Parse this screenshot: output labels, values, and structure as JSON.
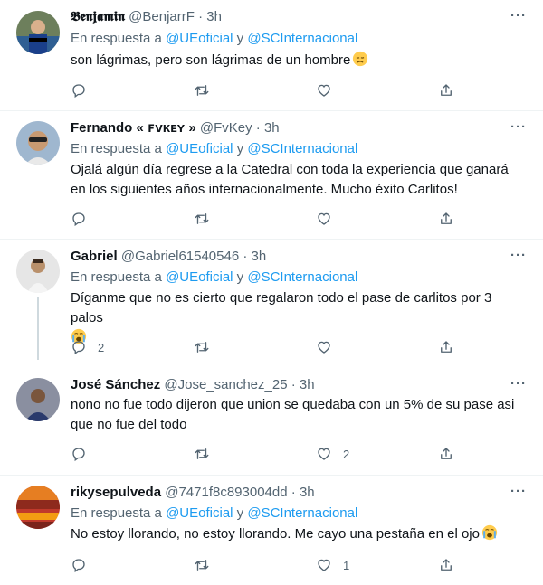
{
  "tweets": [
    {
      "name": "𝕭𝖊𝖓𝖏𝖆𝖒𝖎𝖓",
      "handle": "@BenjarrF",
      "time": "3h",
      "reply_prefix": "En respuesta a",
      "reply_user1": "@UEoficial",
      "reply_and": "y",
      "reply_user2": "@SCInternacional",
      "text": "son lágrimas, pero son lágrimas de un hombre",
      "emoji": "disappointed-face",
      "reply_count": "",
      "retweet_count": "",
      "like_count": ""
    },
    {
      "name": "Fernando « ꜰᴠᴋᴇʏ »",
      "handle": "@FvKey",
      "time": "3h",
      "reply_prefix": "En respuesta a",
      "reply_user1": "@UEoficial",
      "reply_and": "y",
      "reply_user2": "@SCInternacional",
      "text": "Ojalá algún día regrese a la Catedral con toda la experiencia que ganará en los siguientes años internacionalmente. Mucho éxito Carlitos!",
      "reply_count": "",
      "retweet_count": "",
      "like_count": ""
    },
    {
      "name": "Gabriel",
      "handle": "@Gabriel61540546",
      "time": "3h",
      "reply_prefix": "En respuesta a",
      "reply_user1": "@UEoficial",
      "reply_and": "y",
      "reply_user2": "@SCInternacional",
      "text": "Díganme que no es cierto que regalaron todo el pase de carlitos por 3 palos",
      "emoji": "loudly-crying-face",
      "reply_count": "2",
      "retweet_count": "",
      "like_count": ""
    },
    {
      "name": "José Sánchez",
      "handle": "@Jose_sanchez_25",
      "time": "3h",
      "text": "nono no fue todo dijeron que union se quedaba con un 5% de su pase asi que no fue del todo",
      "reply_count": "",
      "retweet_count": "",
      "like_count": "2"
    },
    {
      "name": "rikysepulveda",
      "handle": "@7471f8c893004dd",
      "time": "3h",
      "reply_prefix": "En respuesta a",
      "reply_user1": "@UEoficial",
      "reply_and": "y",
      "reply_user2": "@SCInternacional",
      "text": "No estoy llorando, no estoy llorando. Me cayo una pestaña en el ojo",
      "emoji": "loudly-crying-face",
      "reply_count": "",
      "retweet_count": "",
      "like_count": "1"
    }
  ],
  "dot": "·",
  "more_label": "···",
  "icons": [
    "reply-icon",
    "retweet-icon",
    "like-icon",
    "share-icon"
  ],
  "colors": {
    "link": "#1d9bf0",
    "muted": "#536471",
    "text": "#0f1419"
  }
}
